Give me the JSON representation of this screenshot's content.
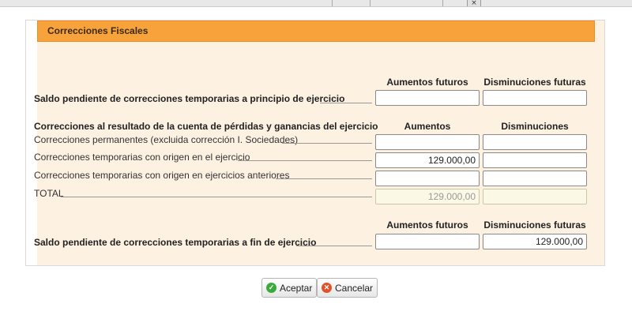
{
  "window": {
    "close_glyph": "×"
  },
  "panel": {
    "title": "Correcciones Fiscales"
  },
  "sections": {
    "saldo_inicio": {
      "label": "Saldo pendiente de correcciones temporarias a principio de ejercicio",
      "col1_header": "Aumentos futuros",
      "col2_header": "Disminuciones futuras",
      "col1_value": "",
      "col2_value": ""
    },
    "correcciones": {
      "heading": "Correcciones al resultado de la cuenta de pérdidas y ganancias del ejercicio",
      "col1_header": "Aumentos",
      "col2_header": "Disminuciones",
      "rows": [
        {
          "label": "Correcciones permanentes (excluida corrección I. Sociedades)",
          "aumentos": "",
          "disminuciones": ""
        },
        {
          "label": "Correcciones temporarias con origen en el ejercicio",
          "aumentos": "129.000,00",
          "disminuciones": ""
        },
        {
          "label": "Correcciones temporarias con origen en ejercicios anteriores",
          "aumentos": "",
          "disminuciones": ""
        },
        {
          "label": "TOTAL",
          "aumentos": "129.000,00",
          "disminuciones": ""
        }
      ]
    },
    "saldo_fin": {
      "label": "Saldo pendiente de correcciones temporarias a fin de ejercicio",
      "col1_header": "Aumentos futuros",
      "col2_header": "Disminuciones futuras",
      "col1_value": "",
      "col2_value": "129.000,00"
    }
  },
  "buttons": {
    "accept": "Aceptar",
    "cancel": "Cancelar"
  },
  "colors": {
    "header_orange": "#f7a23a",
    "panel_bg": "#fdf1e2"
  }
}
